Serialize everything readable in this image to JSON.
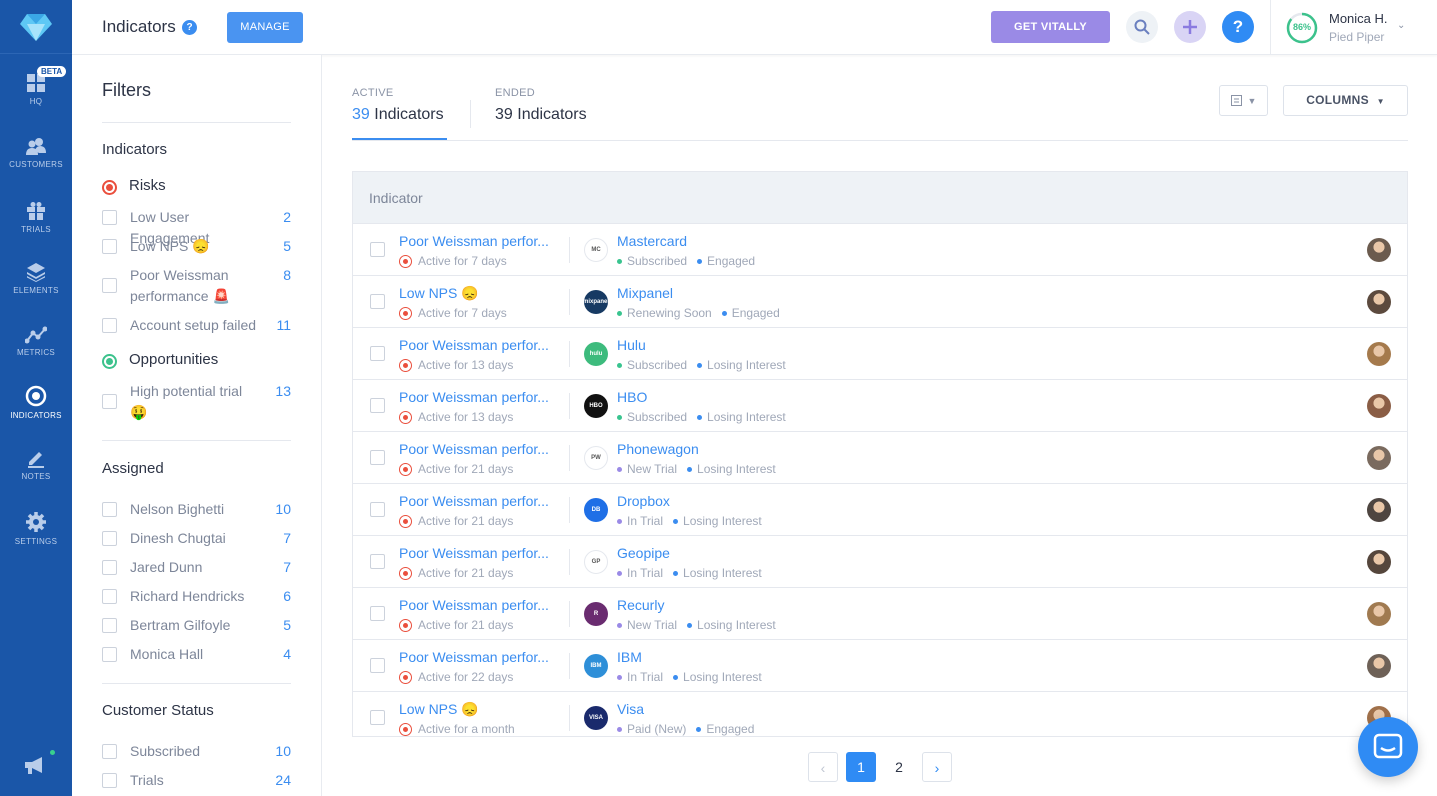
{
  "sidebar": {
    "beta": "BETA",
    "items": [
      {
        "label": "HQ",
        "icon": "hq-grid-icon"
      },
      {
        "label": "CUSTOMERS",
        "icon": "customers-icon"
      },
      {
        "label": "TRIALS",
        "icon": "gift-icon"
      },
      {
        "label": "ELEMENTS",
        "icon": "layers-icon"
      },
      {
        "label": "METRICS",
        "icon": "metrics-icon"
      },
      {
        "label": "INDICATORS",
        "icon": "target-icon"
      },
      {
        "label": "NOTES",
        "icon": "pencil-icon"
      },
      {
        "label": "SETTINGS",
        "icon": "gear-icon"
      }
    ]
  },
  "header": {
    "title": "Indicators",
    "help": "?",
    "manage_label": "MANAGE",
    "vitally_label": "GET VITALLY",
    "health": "86%",
    "user_name": "Monica H.",
    "user_company": "Pied Piper"
  },
  "filters": {
    "title": "Filters",
    "indicators_title": "Indicators",
    "risks_label": "Risks",
    "risks": [
      {
        "label": "Low User Engagement",
        "count": "2"
      },
      {
        "label": "Low NPS 😞",
        "count": "5"
      },
      {
        "label": "Poor Weissman performance 🚨",
        "count": "8"
      },
      {
        "label": "Account setup failed",
        "count": "11"
      }
    ],
    "opportunities_label": "Opportunities",
    "opportunities": [
      {
        "label": "High potential trial 🤑",
        "count": "13"
      }
    ],
    "assigned_title": "Assigned",
    "assigned": [
      {
        "label": "Nelson Bighetti",
        "count": "10"
      },
      {
        "label": "Dinesh Chugtai",
        "count": "7"
      },
      {
        "label": "Jared Dunn",
        "count": "7"
      },
      {
        "label": "Richard Hendricks",
        "count": "6"
      },
      {
        "label": "Bertram Gilfoyle",
        "count": "5"
      },
      {
        "label": "Monica Hall",
        "count": "4"
      }
    ],
    "status_title": "Customer Status",
    "status": [
      {
        "label": "Subscribed",
        "count": "10"
      },
      {
        "label": "Trials",
        "count": "24"
      }
    ]
  },
  "tabs": {
    "active_small": "ACTIVE",
    "active_num": "39",
    "active_label": "Indicators",
    "ended_small": "ENDED",
    "ended_text": "39 Indicators"
  },
  "toolbar": {
    "columns_label": "COLUMNS"
  },
  "table": {
    "header": "Indicator",
    "rows": [
      {
        "indicator": "Poor Weissman perfor...",
        "active": "Active for 7 days",
        "customer": "Mastercard",
        "logo": "MC",
        "logo_bg": "#ffffff",
        "tags": [
          {
            "t": "Subscribed",
            "c": "#39c48f"
          },
          {
            "t": "Engaged",
            "c": "#3b8df0"
          }
        ],
        "avatar": "#6b5b4e"
      },
      {
        "indicator": "Low NPS 😞",
        "active": "Active for 7 days",
        "customer": "Mixpanel",
        "logo": "mixpanel",
        "logo_bg": "#173a63",
        "tags": [
          {
            "t": "Renewing Soon",
            "c": "#39c48f"
          },
          {
            "t": "Engaged",
            "c": "#3b8df0"
          }
        ],
        "avatar": "#5c4a3e"
      },
      {
        "indicator": "Poor Weissman perfor...",
        "active": "Active for 13 days",
        "customer": "Hulu",
        "logo": "hulu",
        "logo_bg": "#3dbb7d",
        "tags": [
          {
            "t": "Subscribed",
            "c": "#39c48f"
          },
          {
            "t": "Losing Interest",
            "c": "#3b8df0"
          }
        ],
        "avatar": "#a57a4c"
      },
      {
        "indicator": "Poor Weissman perfor...",
        "active": "Active for 13 days",
        "customer": "HBO",
        "logo": "HBO",
        "logo_bg": "#111111",
        "tags": [
          {
            "t": "Subscribed",
            "c": "#39c48f"
          },
          {
            "t": "Losing Interest",
            "c": "#3b8df0"
          }
        ],
        "avatar": "#8a5d45"
      },
      {
        "indicator": "Poor Weissman perfor...",
        "active": "Active for 21 days",
        "customer": "Phonewagon",
        "logo": "PW",
        "logo_bg": "#ffffff",
        "tags": [
          {
            "t": "New Trial",
            "c": "#9a8ae6"
          },
          {
            "t": "Losing Interest",
            "c": "#3b8df0"
          }
        ],
        "avatar": "#7a6a5e"
      },
      {
        "indicator": "Poor Weissman perfor...",
        "active": "Active for 21 days",
        "customer": "Dropbox",
        "logo": "DB",
        "logo_bg": "#1f6fe6",
        "tags": [
          {
            "t": "In Trial",
            "c": "#9a8ae6"
          },
          {
            "t": "Losing Interest",
            "c": "#3b8df0"
          }
        ],
        "avatar": "#4e4540"
      },
      {
        "indicator": "Poor Weissman perfor...",
        "active": "Active for 21 days",
        "customer": "Geopipe",
        "logo": "GP",
        "logo_bg": "#ffffff",
        "tags": [
          {
            "t": "In Trial",
            "c": "#9a8ae6"
          },
          {
            "t": "Losing Interest",
            "c": "#3b8df0"
          }
        ],
        "avatar": "#55463c"
      },
      {
        "indicator": "Poor Weissman perfor...",
        "active": "Active for 21 days",
        "customer": "Recurly",
        "logo": "R",
        "logo_bg": "#6a2c70",
        "tags": [
          {
            "t": "New Trial",
            "c": "#9a8ae6"
          },
          {
            "t": "Losing Interest",
            "c": "#3b8df0"
          }
        ],
        "avatar": "#a07a50"
      },
      {
        "indicator": "Poor Weissman perfor...",
        "active": "Active for 22 days",
        "customer": "IBM",
        "logo": "IBM",
        "logo_bg": "#2e8fd8",
        "tags": [
          {
            "t": "In Trial",
            "c": "#9a8ae6"
          },
          {
            "t": "Losing Interest",
            "c": "#3b8df0"
          }
        ],
        "avatar": "#6e6157"
      },
      {
        "indicator": "Low NPS 😞",
        "active": "Active for a month",
        "customer": "Visa",
        "logo": "VISA",
        "logo_bg": "#1a2a6c",
        "tags": [
          {
            "t": "Paid (New)",
            "c": "#9a8ae6"
          },
          {
            "t": "Engaged",
            "c": "#3b8df0"
          }
        ],
        "avatar": "#a0704a"
      }
    ]
  },
  "pagination": {
    "pages": [
      "1",
      "2"
    ],
    "current": "1"
  }
}
